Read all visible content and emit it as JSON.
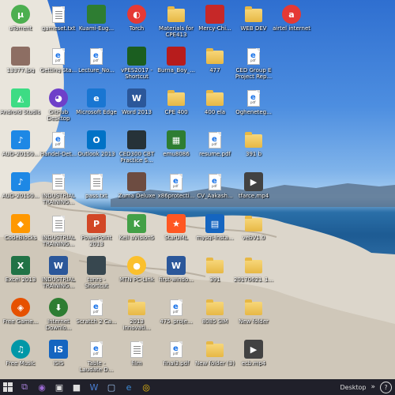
{
  "desktop": {
    "icons": [
      {
        "label": "uTorrent",
        "kind": "utorrent",
        "color": "#4caf50"
      },
      {
        "label": "gameset.txt",
        "kind": "text"
      },
      {
        "label": "Kuami-Eug...",
        "kind": "image",
        "color": "#2e7d32"
      },
      {
        "label": "Torch",
        "kind": "torch",
        "color": "#e53935"
      },
      {
        "label": "Materials for CPE413",
        "kind": "folder"
      },
      {
        "label": "Mercy-Chi...",
        "kind": "image",
        "color": "#c62828"
      },
      {
        "label": "WEB DEV",
        "kind": "folder"
      },
      {
        "label": "airtel internet",
        "kind": "airtel",
        "color": "#e53935"
      },
      {
        "label": "13377.jpg",
        "kind": "image",
        "color": "#8d6e63"
      },
      {
        "label": "Getting Sta...",
        "kind": "edge-pdf"
      },
      {
        "label": "Lecture_No...",
        "kind": "edge-pdf"
      },
      {
        "label": "vPES2017 - Shortcut",
        "kind": "image",
        "color": "#1b5e20"
      },
      {
        "label": "Burna_Boy_...",
        "kind": "image",
        "color": "#b71c1c"
      },
      {
        "label": "477",
        "kind": "folder"
      },
      {
        "label": "CED Group E Project Rep...",
        "kind": "edge-pdf"
      },
      {
        "label": "Android Studio",
        "kind": "android",
        "color": "#3ddc84"
      },
      {
        "label": "GitHub Desktop",
        "kind": "github",
        "color": "#6e40c9"
      },
      {
        "label": "Microsoft Edge",
        "kind": "edge",
        "color": "#1976d2"
      },
      {
        "label": "Word 2013",
        "kind": "word",
        "color": "#2b579a"
      },
      {
        "label": "CPE 400",
        "kind": "folder"
      },
      {
        "label": "400 ela",
        "kind": "folder"
      },
      {
        "label": "Ogheneteg...",
        "kind": "edge-pdf"
      },
      {
        "label": "AUD-20150...",
        "kind": "audio",
        "color": "#1e88e5"
      },
      {
        "label": "Handel-Det...",
        "kind": "edge-pdf"
      },
      {
        "label": "Outlook 2013",
        "kind": "outlook",
        "color": "#0072c6"
      },
      {
        "label": "CED300 CBT Practice S...",
        "kind": "image",
        "color": "#263238"
      },
      {
        "label": "emu8086",
        "kind": "chip",
        "color": "#2e7d32"
      },
      {
        "label": "resume.pdf",
        "kind": "edge-pdf"
      },
      {
        "label": "391 b",
        "kind": "folder"
      },
      {
        "label": "AUD-20150...",
        "kind": "audio",
        "color": "#1e88e5"
      },
      {
        "label": "INDUSTRIAL TRAINING...",
        "kind": "text"
      },
      {
        "label": "pass.txt",
        "kind": "text"
      },
      {
        "label": "Zuma Deluxe",
        "kind": "image",
        "color": "#6d4c41"
      },
      {
        "label": "x86protecti...",
        "kind": "edge-pdf"
      },
      {
        "label": "CV_Aakash...",
        "kind": "edge-pdf"
      },
      {
        "label": "tfarce.mp4",
        "kind": "video",
        "color": "#424242"
      },
      {
        "label": "CodeBlocks",
        "kind": "codeblocks",
        "color": "#ff9800"
      },
      {
        "label": "INDUSTRIAL TRAINING...",
        "kind": "text"
      },
      {
        "label": "PowerPoint 2013",
        "kind": "ppt",
        "color": "#d24726"
      },
      {
        "label": "Keil uVision5",
        "kind": "keil",
        "color": "#43a047"
      },
      {
        "label": "StarUML",
        "kind": "staruml",
        "color": "#ff5722"
      },
      {
        "label": "mysql-insta...",
        "kind": "installer",
        "color": "#1565c0"
      },
      {
        "label": "vebV1.0",
        "kind": "folder"
      },
      {
        "label": "Excel 2013",
        "kind": "excel",
        "color": "#217346"
      },
      {
        "label": "INDUSTRIAL TRAINING...",
        "kind": "word",
        "color": "#2b579a"
      },
      {
        "label": "tunrs - Shortcut",
        "kind": "image",
        "color": "#37474f"
      },
      {
        "label": "MTN PC-Link",
        "kind": "mtn",
        "color": "#fbc02d"
      },
      {
        "label": "first-windo...",
        "kind": "word",
        "color": "#2b579a"
      },
      {
        "label": "391",
        "kind": "folder"
      },
      {
        "label": "20170621_1...",
        "kind": "folder"
      },
      {
        "label": "Free Game...",
        "kind": "games",
        "color": "#e65100"
      },
      {
        "label": "Internet Downlo...",
        "kind": "idm",
        "color": "#2e7d32"
      },
      {
        "label": "Scratch 2 Ca...",
        "kind": "edge-pdf"
      },
      {
        "label": "2013 innovati...",
        "kind": "folder"
      },
      {
        "label": "475_proje...",
        "kind": "edge-pdf"
      },
      {
        "label": "8085 SIM",
        "kind": "folder"
      },
      {
        "label": "New folder",
        "kind": "folder"
      },
      {
        "label": "Free Music",
        "kind": "music",
        "color": "#0097a7"
      },
      {
        "label": "ISIS",
        "kind": "isis",
        "color": "#1565c0"
      },
      {
        "label": "Table - Laudate D...",
        "kind": "edge-pdf"
      },
      {
        "label": "film",
        "kind": "text"
      },
      {
        "label": "final3.pdf",
        "kind": "edge-pdf"
      },
      {
        "label": "New folder (3)",
        "kind": "folder"
      },
      {
        "label": "ecb.mp4",
        "kind": "video",
        "color": "#424242"
      }
    ]
  },
  "taskbar": {
    "apps": [
      {
        "icon": "vs-icon",
        "glyph": "⧉",
        "color": "#a77fd8"
      },
      {
        "icon": "onenote-icon",
        "glyph": "◉",
        "color": "#9c6ad3"
      },
      {
        "icon": "store-icon",
        "glyph": "▣",
        "color": "#dddddd"
      },
      {
        "icon": "app-icon",
        "glyph": "■",
        "color": "#dddddd"
      },
      {
        "icon": "word-icon",
        "glyph": "W",
        "color": "#4a7fd4"
      },
      {
        "icon": "window-icon",
        "glyph": "▢",
        "color": "#9fc3f0"
      },
      {
        "icon": "edge-icon",
        "glyph": "e",
        "color": "#3d8bd8"
      },
      {
        "icon": "chrome-icon",
        "glyph": "◎",
        "color": "#f4c20d"
      }
    ],
    "desktop_label": "Desktop",
    "chevron": "»",
    "help": "?"
  }
}
